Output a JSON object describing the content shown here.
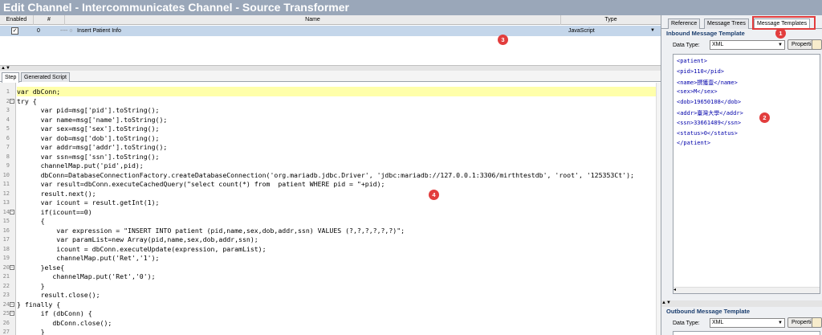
{
  "window": {
    "title": "Edit Channel - Intercommunicates Channel - Source Transformer"
  },
  "steps_table": {
    "columns": [
      "Enabled",
      "#",
      "Name",
      "Type"
    ],
    "rows": [
      {
        "enabled": "✓",
        "number": "0",
        "name": "Insert Patient Info",
        "type": "JavaScript"
      }
    ]
  },
  "editor_tabs": [
    "Step",
    "Generated Script"
  ],
  "editor": {
    "line_numbers": [
      "1",
      "2",
      "3",
      "4",
      "5",
      "6",
      "7",
      "8",
      "9",
      "10",
      "11",
      "12",
      "13",
      "14",
      "15",
      "16",
      "17",
      "18",
      "19",
      "20",
      "21",
      "22",
      "23",
      "24",
      "25",
      "26",
      "27"
    ],
    "lines": [
      "var dbConn;",
      "try {",
      "      var pid=msg['pid'].toString();",
      "      var name=msg['name'].toString();",
      "      var sex=msg['sex'].toString();",
      "      var dob=msg['dob'].toString();",
      "      var addr=msg['addr'].toString();",
      "      var ssn=msg['ssn'].toString();",
      "      channelMap.put('pid',pid);",
      "      dbConn=DatabaseConnectionFactory.createDatabaseConnection('org.mariadb.jdbc.Driver', 'jdbc:mariadb://127.0.0.1:3306/mirthtestdb', 'root', '125353Ct');",
      "      var result=dbConn.executeCachedQuery(\"select count(*) from  patient WHERE pid = \"+pid);",
      "      result.next();",
      "      var icount = result.getInt(1);",
      "      if(icount==0)",
      "      {",
      "          var expression = \"INSERT INTO patient (pid,name,sex,dob,addr,ssn) VALUES (?,?,?,?,?,?)\";",
      "          var paramList=new Array(pid,name,sex,dob,addr,ssn);",
      "          icount = dbConn.executeUpdate(expression, paramList);",
      "          channelMap.put('Ret','1');",
      "      }else{",
      "         channelMap.put('Ret','0');",
      "      }",
      "      result.close();",
      "} finally {",
      "      if (dbConn) {",
      "         dbConn.close();",
      "      }",
      "}"
    ]
  },
  "right_panel": {
    "tabs": [
      "Reference",
      "Message Trees",
      "Message Templates"
    ],
    "inbound": {
      "title": "Inbound Message Template",
      "data_type_label": "Data Type:",
      "data_type_value": "XML",
      "properties_label": "Properties",
      "lines": [
        "<patient>",
        "<pid>110</pid>",
        "<name>撰獲壹</name>",
        "<sex>M</sex>",
        "<dob>19650108</dob>",
        "<addr>臺灣大學</addr>",
        "<ssn>33661489</ssn>",
        "<status>0</status>",
        "</patient>"
      ]
    },
    "outbound": {
      "title": "Outbound Message Template",
      "data_type_label": "Data Type:",
      "data_type_value": "XML",
      "properties_label": "Properties"
    }
  },
  "annotations": [
    "1",
    "2",
    "3",
    "4"
  ],
  "colors": {
    "annotation": "#e23d3d",
    "titlebar": "#9aa7b9",
    "highlight_line": "#ffffaa",
    "selected_row": "#c4d6ea"
  }
}
